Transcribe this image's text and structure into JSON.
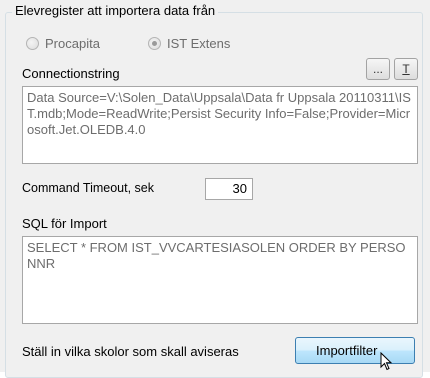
{
  "group": {
    "title": "Elevregister att importera data från"
  },
  "source": {
    "options": [
      {
        "label": "Procapita",
        "selected": false
      },
      {
        "label": "IST Extens",
        "selected": true
      }
    ]
  },
  "connection": {
    "label": "Connectionstring",
    "browse_button": "...",
    "test_button": "T",
    "value": "Data Source=V:\\Solen_Data\\Uppsala\\Data fr Uppsala 20110311\\IST.mdb;Mode=ReadWrite;Persist Security Info=False;Provider=Microsoft.Jet.OLEDB.4.0"
  },
  "timeout": {
    "label": "Command Timeout, sek",
    "value": "30"
  },
  "sql": {
    "label": "SQL för Import",
    "value": "SELECT * FROM IST_VVCARTESIASOLEN ORDER BY PERSONNR"
  },
  "footer": {
    "label": "Ställ in vilka skolor som skall aviseras",
    "import_button": "Importfilter"
  }
}
